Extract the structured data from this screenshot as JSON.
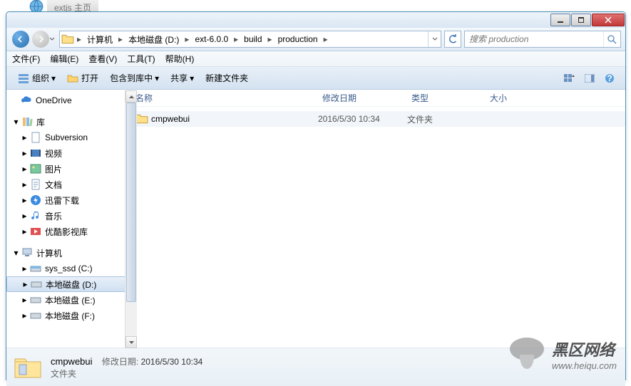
{
  "bgtab": "extjs 主页",
  "breadcrumb": [
    "计算机",
    "本地磁盘 (D:)",
    "ext-6.0.0",
    "build",
    "production"
  ],
  "search": {
    "placeholder": "搜索 production"
  },
  "menubar": [
    "文件(F)",
    "编辑(E)",
    "查看(V)",
    "工具(T)",
    "帮助(H)"
  ],
  "toolbar": {
    "organize": "组织",
    "open": "打开",
    "include": "包含到库中",
    "share": "共享",
    "newfolder": "新建文件夹"
  },
  "tree": {
    "onedrive": "OneDrive",
    "lib": "库",
    "lib_items": [
      "Subversion",
      "视频",
      "图片",
      "文档",
      "迅雷下载",
      "音乐",
      "优酷影视库"
    ],
    "computer": "计算机",
    "drives": [
      "sys_ssd (C:)",
      "本地磁盘 (D:)",
      "本地磁盘 (E:)",
      "本地磁盘 (F:)"
    ]
  },
  "columns": {
    "name": "名称",
    "date": "修改日期",
    "type": "类型",
    "size": "大小"
  },
  "rows": [
    {
      "name": "cmpwebui",
      "date": "2016/5/30 10:34",
      "type": "文件夹"
    }
  ],
  "details": {
    "name": "cmpwebui",
    "date_label": "修改日期:",
    "date": "2016/5/30 10:34",
    "type": "文件夹"
  },
  "watermark": {
    "text": "黑区网络",
    "url": "www.heiqu.com"
  }
}
